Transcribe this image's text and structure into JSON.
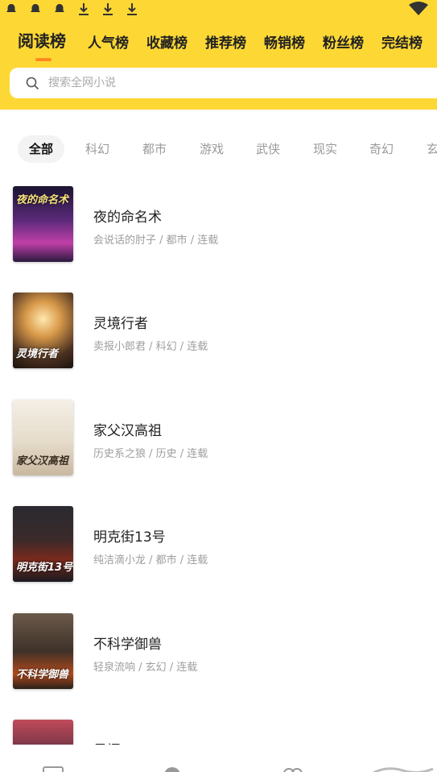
{
  "rank_tabs": [
    "阅读榜",
    "人气榜",
    "收藏榜",
    "推荐榜",
    "畅销榜",
    "粉丝榜",
    "完结榜"
  ],
  "search": {
    "placeholder": "搜索全网小说"
  },
  "categories": [
    "全部",
    "科幻",
    "都市",
    "游戏",
    "武侠",
    "现实",
    "奇幻",
    "玄"
  ],
  "books": [
    {
      "title": "夜的命名术",
      "meta": "会说话的肘子 / 都市 / 连载",
      "cover_text": "夜的命名术"
    },
    {
      "title": "灵境行者",
      "meta": "卖报小郎君 / 科幻 / 连载",
      "cover_text": "灵境行者"
    },
    {
      "title": "家父汉高祖",
      "meta": "历史系之狼 / 历史 / 连载",
      "cover_text": "家父汉高祖"
    },
    {
      "title": "明克街13号",
      "meta": "纯洁滴小龙 / 都市 / 连载",
      "cover_text": "明克街13号"
    },
    {
      "title": "不科学御兽",
      "meta": "轻泉流响 / 玄幻 / 连载",
      "cover_text": "不科学御兽"
    },
    {
      "title": "星门",
      "meta": "",
      "cover_text": ""
    }
  ],
  "colors": {
    "header": "#FDD835",
    "accent": "#ff8a1f"
  },
  "icons": {
    "status": [
      "notification-icon",
      "notification-icon",
      "notification-icon",
      "download-icon",
      "download-icon",
      "download-icon"
    ],
    "wifi": "wifi-icon",
    "search": "search-icon"
  }
}
